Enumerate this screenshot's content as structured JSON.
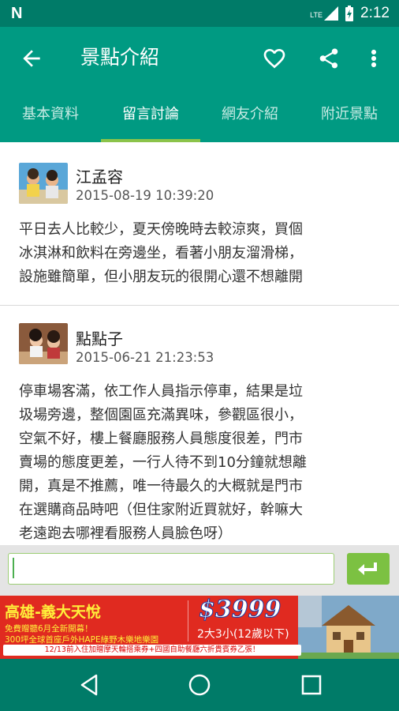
{
  "status_bar": {
    "lte": "LTE",
    "time": "2:12"
  },
  "app_bar": {
    "title": "景點介紹"
  },
  "tabs": [
    {
      "label": "基本資料"
    },
    {
      "label": "留言討論"
    },
    {
      "label": "網友介紹"
    },
    {
      "label": "附近景點"
    }
  ],
  "comments": [
    {
      "author": "江孟容",
      "date": "2015-08-19 10:39:20",
      "text": "平日去人比較少，夏天傍晚時去較涼爽，買個\n冰淇淋和飲料在旁邊坐，看著小朋友溜滑梯，\n設施雖簡單，但小朋友玩的很開心還不想離開"
    },
    {
      "author": "點點子",
      "date": "2015-06-21 21:23:53",
      "text": "停車場客滿，依工作人員指示停車，結果是垃\n圾場旁邊，整個園區充滿異味，參觀區很小，\n空氣不好，樓上餐廳服務人員態度很差，門市\n賣場的態度更差，一行人待不到10分鐘就想離\n開，真是不推薦，唯一待最久的大概就是門市\n在選購商品時吧（但住家附近買就好，幹嘛大\n老遠跑去哪裡看服務人員臉色呀）"
    }
  ],
  "input": {
    "value": ""
  },
  "ad": {
    "title": "高雄-義大天悅",
    "line2": "免費贈聽6月全新開幕！",
    "line3": "300坪全球首座戶外HAPE綠野木樂地樂園",
    "price": "$3999",
    "price_sub": "2大3小(12歲以下)",
    "bottom": "12/13前入住加贈摩天輪搭乘券+四國自助餐廳六折貴賓券乙張！"
  },
  "colors": {
    "primary": "#009a82",
    "primary_dark": "#007b68",
    "accent": "#8bc34a"
  }
}
